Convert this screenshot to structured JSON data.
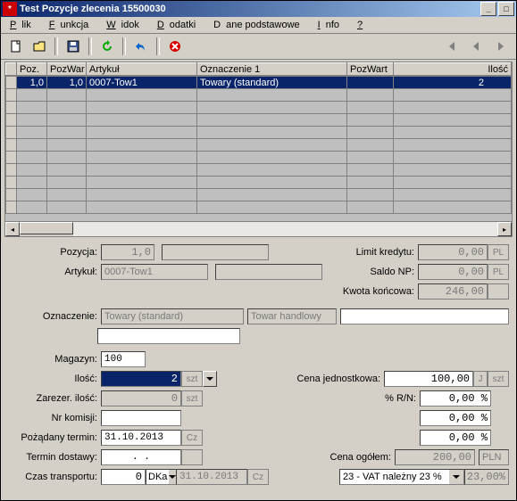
{
  "title": "Test Pozycje zlecenia 15500030",
  "menu": {
    "plik": "lik",
    "funkcja": "unkcja",
    "widok": "idok",
    "dodatki": "odatki",
    "dane": "ane podstawowe",
    "info": "nfo",
    "help": "?"
  },
  "grid": {
    "cols": [
      "Poz.",
      "PozWar",
      "Artykuł",
      "Oznaczenie 1",
      "PozWart",
      "Ilość"
    ],
    "rows": [
      {
        "poz": "1,0",
        "pozwar": "1,0",
        "artykul": "0007-Tow1",
        "oznaczenie": "Towary (standard)",
        "pozwart": "",
        "ilosc": "2"
      }
    ]
  },
  "form": {
    "l_pozycja": "Pozycja:",
    "pozycja": "1,0",
    "l_artykul": "Artykuł:",
    "artykul": "0007-Tow1",
    "l_limit": "Limit kredytu:",
    "limit": "0,00",
    "l_saldo": "Saldo NP:",
    "saldo": "0,00",
    "l_kwota": "Kwota końcowa:",
    "kwota": "246,00",
    "l_oznaczenie": "Oznaczenie:",
    "oznaczenie": "Towary (standard)",
    "typ_towaru": "Towar handlowy",
    "l_magazyn": "Magazyn:",
    "magazyn": "100",
    "l_ilosc": "Ilość:",
    "ilosc": "2",
    "l_cena": "Cena jednostkowa:",
    "cena": "100,00",
    "l_zarezer": "Zarezer. ilość:",
    "zarezer": "0",
    "l_rn": "% R/N:",
    "rn1": "0,00 %",
    "rn2": "0,00 %",
    "rn3": "0,00 %",
    "l_komisja": "Nr komisji:",
    "l_termin": "Pożądany termin:",
    "termin": "31.10.2013",
    "l_dostawa": "Termin dostawy:",
    "dostawa": ".  .",
    "l_ogolem": "Cena ogółem:",
    "ogolem": "200,00",
    "l_transport": "Czas transportu:",
    "transport": "0",
    "transport_date": "31.10.2013",
    "vat": "23 - VAT należny 23 %",
    "vat_pct": "23,00%",
    "szt": "szt",
    "cz": "Cz",
    "j": "J",
    "dka": "DKa",
    "pln": "PL",
    "pln_full": "PLN"
  }
}
